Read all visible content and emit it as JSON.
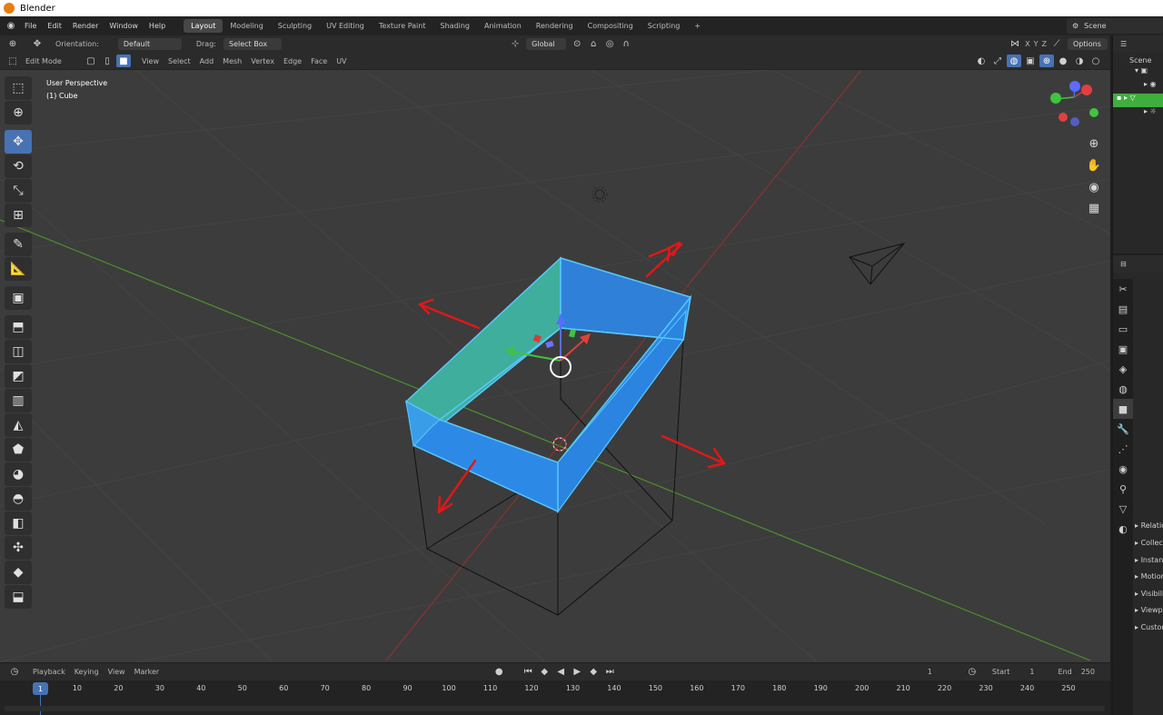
{
  "window": {
    "title": "Blender"
  },
  "menu": [
    "File",
    "Edit",
    "Render",
    "Window",
    "Help"
  ],
  "workspaces": [
    "Layout",
    "Modeling",
    "Sculpting",
    "UV Editing",
    "Texture Paint",
    "Shading",
    "Animation",
    "Rendering",
    "Compositing",
    "Scripting"
  ],
  "active_workspace": "Layout",
  "add_tab": "+",
  "scene_name": "Scene",
  "tool_header": {
    "orientation_label": "Orientation:",
    "orientation_value": "Default",
    "drag_label": "Drag:",
    "drag_value": "Select Box",
    "transform_orientation": "Global",
    "axes": [
      "X",
      "Y",
      "Z"
    ],
    "options": "Options"
  },
  "edit_header": {
    "mode": "Edit Mode",
    "menus": [
      "View",
      "Select",
      "Add",
      "Mesh",
      "Vertex",
      "Edge",
      "Face",
      "UV"
    ]
  },
  "viewport": {
    "perspective": "User Perspective",
    "object": "(1) Cube"
  },
  "outliner": {
    "scene": "Scene"
  },
  "properties": {
    "items": [
      "Relations",
      "Collections",
      "Instancing",
      "Motion Paths",
      "Visibility",
      "Viewport Display",
      "Custom Properties"
    ]
  },
  "timeline": {
    "menus": [
      "Playback",
      "Keying",
      "View",
      "Marker"
    ],
    "current_frame": "1",
    "start_label": "Start",
    "start_value": "1",
    "end_label": "End",
    "end_value": "250",
    "frames": [
      "1",
      "10",
      "20",
      "30",
      "40",
      "50",
      "60",
      "70",
      "80",
      "90",
      "100",
      "110",
      "120",
      "130",
      "140",
      "150",
      "160",
      "170",
      "180",
      "190",
      "200",
      "210",
      "220",
      "230",
      "240",
      "250"
    ]
  },
  "colors": {
    "accent": "#4772b3",
    "selected_face": "#2d8fe6",
    "x_axis": "#c8282d",
    "y_axis": "#3cb43c",
    "annotation_arrow": "#e01818"
  }
}
